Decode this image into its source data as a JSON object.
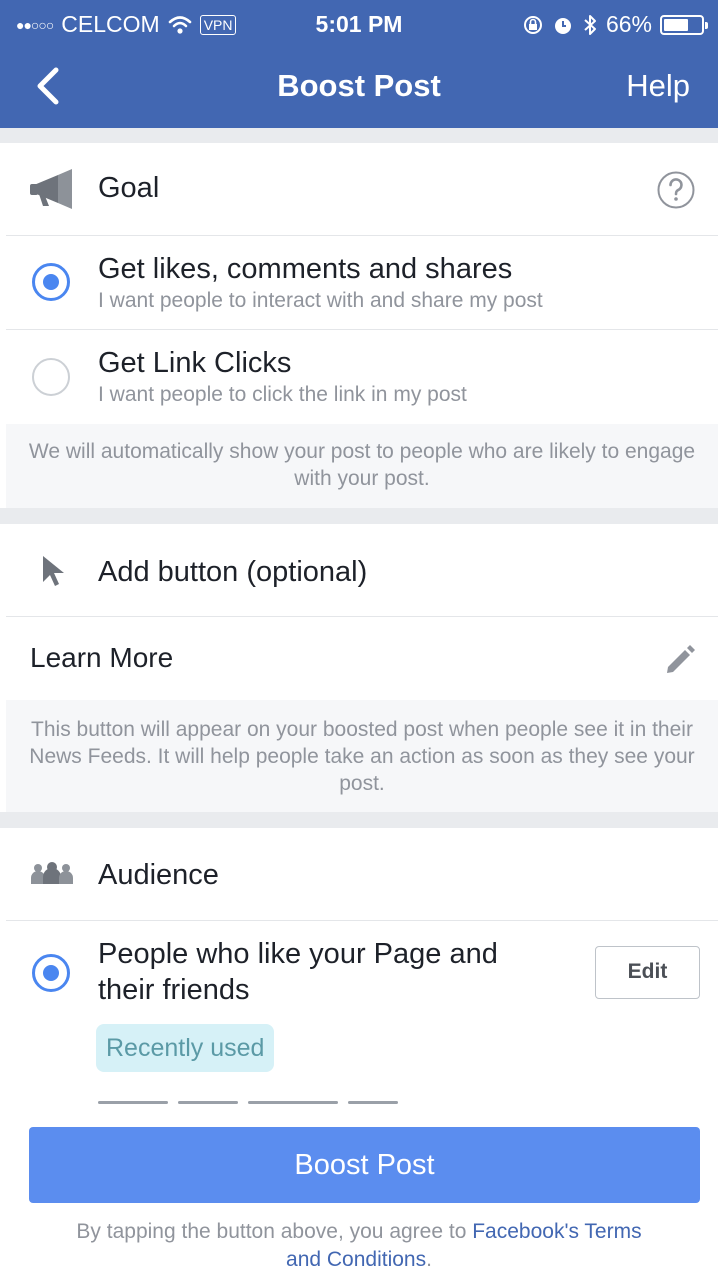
{
  "status_bar": {
    "signal": "●●○○○",
    "carrier": "CELCOM",
    "vpn": "VPN",
    "time": "5:01 PM",
    "battery_text": "66%",
    "battery_level": 0.66
  },
  "nav": {
    "title": "Boost Post",
    "help": "Help"
  },
  "goal": {
    "title": "Goal",
    "options": [
      {
        "title": "Get likes, comments and shares",
        "subtitle": "I want people to interact with and share my post",
        "selected": true
      },
      {
        "title": "Get Link Clicks",
        "subtitle": "I want people to click the link in my post",
        "selected": false
      }
    ],
    "info": "We will automatically show your post to people who are likely to engage with your post."
  },
  "add_button": {
    "title": "Add button (optional)",
    "selected_label": "Learn More",
    "info": "This button will appear on your boosted post when people see it in their News Feeds. It will help people take an action as soon as they see your post."
  },
  "audience": {
    "title": "Audience",
    "option_line1": "People who like your Page and",
    "option_line2": "their friends",
    "edit_label": "Edit",
    "badge": "Recently used"
  },
  "footer": {
    "boost_label": "Boost Post",
    "terms_prefix": "By tapping the button above, you agree to ",
    "terms_link_1": "Facebook's Terms",
    "terms_link_2": "and Conditions",
    "terms_suffix": "."
  },
  "colors": {
    "brand": "#4267b2",
    "radio_on": "#4a86f0",
    "button": "#5b8def"
  }
}
